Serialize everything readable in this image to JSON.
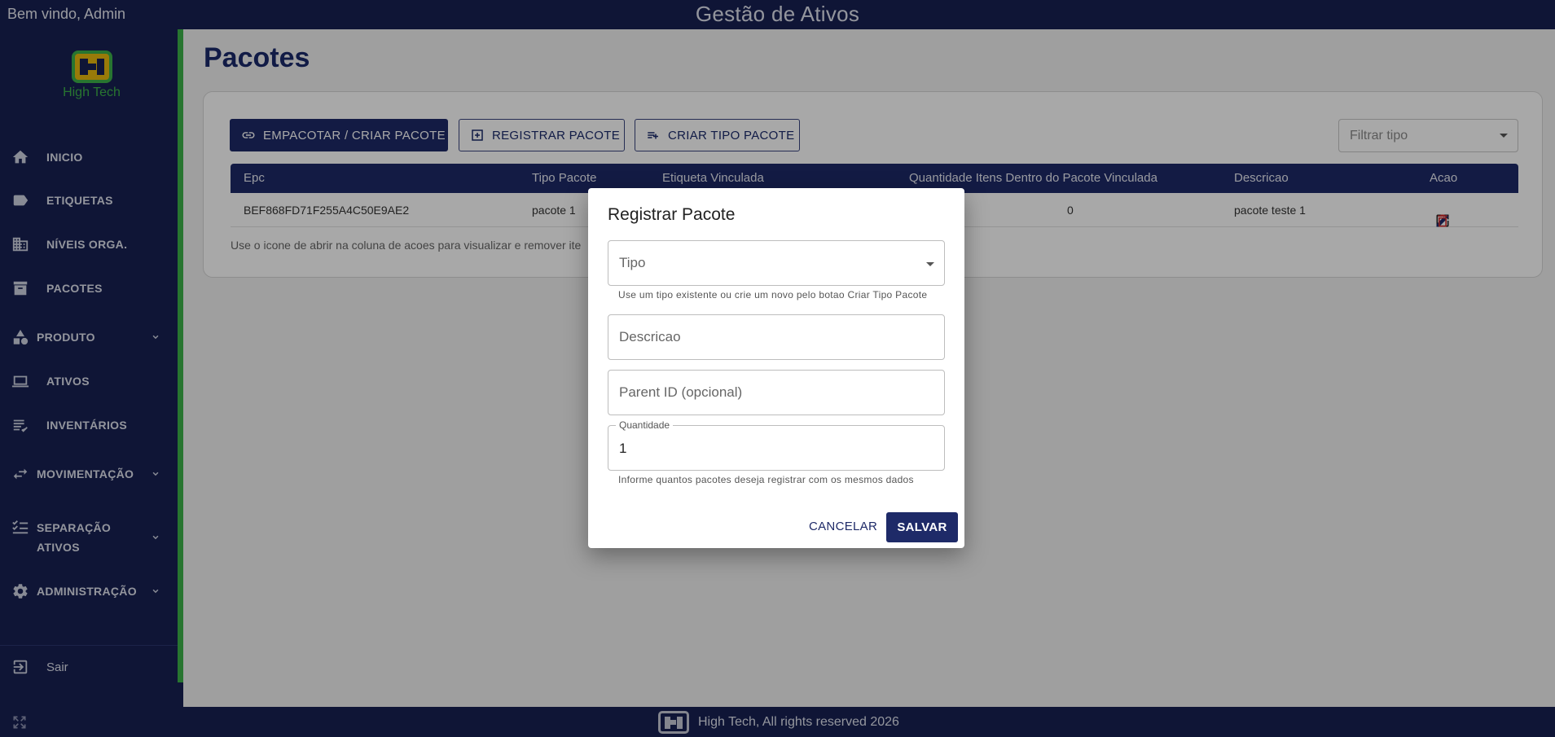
{
  "header": {
    "welcome": "Bem vindo, Admin",
    "app_title": "Gestão de Ativos"
  },
  "sidebar": {
    "brand": "High Tech",
    "items": [
      {
        "label": "INICIO",
        "icon": "home-icon"
      },
      {
        "label": "ETIQUETAS",
        "icon": "label-icon"
      },
      {
        "label": "NÍVEIS ORGA.",
        "icon": "building-icon"
      },
      {
        "label": "PACOTES",
        "icon": "archive-icon"
      },
      {
        "label": "PRODUTO",
        "icon": "category-icon",
        "expandable": true
      },
      {
        "label": "ATIVOS",
        "icon": "laptop-icon"
      },
      {
        "label": "INVENTÁRIOS",
        "icon": "checklist-icon"
      },
      {
        "label": "MOVIMENTAÇÃO",
        "icon": "swap-icon",
        "expandable": true
      },
      {
        "label": "SEPARAÇÃO ATIVOS",
        "label_line1": "SEPARAÇÃO",
        "label_line2": "ATIVOS",
        "icon": "task-list-icon",
        "expandable": true
      },
      {
        "label": "ADMINISTRAÇÃO",
        "icon": "gear-icon",
        "expandable": true
      }
    ],
    "logout": "Sair"
  },
  "main": {
    "title": "Pacotes",
    "buttons": {
      "pack": "EMPACOTAR / CRIAR PACOTE",
      "register": "REGISTRAR PACOTE",
      "create_type": "CRIAR TIPO PACOTE"
    },
    "filter_placeholder": "Filtrar tipo",
    "table": {
      "columns": [
        "Epc",
        "Tipo Pacote",
        "Etiqueta Vinculada",
        "Quantidade Itens Dentro do Pacote Vinculada",
        "Descricao",
        "Acao"
      ],
      "rows": [
        {
          "epc": "BEF868FD71F255A4C50E9AE2",
          "tipo": "pacote 1",
          "etiqueta": "",
          "quantidade": "0",
          "descricao": "pacote teste 1"
        }
      ]
    },
    "hint": "Use o icone de abrir na coluna de acoes para visualizar e remover ite"
  },
  "footer": {
    "text": "High Tech, All rights reserved 2026"
  },
  "dialog": {
    "title": "Registrar Pacote",
    "tipo_label": "Tipo",
    "tipo_helper": "Use um tipo existente ou crie um novo pelo botao Criar Tipo Pacote",
    "descricao_label": "Descricao",
    "parent_label": "Parent ID (opcional)",
    "quantidade_label": "Quantidade",
    "quantidade_value": "1",
    "quantidade_helper": "Informe quantos pacotes deseja registrar com os mesmos dados",
    "cancel": "CANCELAR",
    "save": "SALVAR"
  },
  "colors": {
    "navy": "#172052",
    "primary": "#1e2a68",
    "accent_green": "#3db24a",
    "logo_yellow": "#e8b90f",
    "delete_red": "#d32f2f"
  }
}
